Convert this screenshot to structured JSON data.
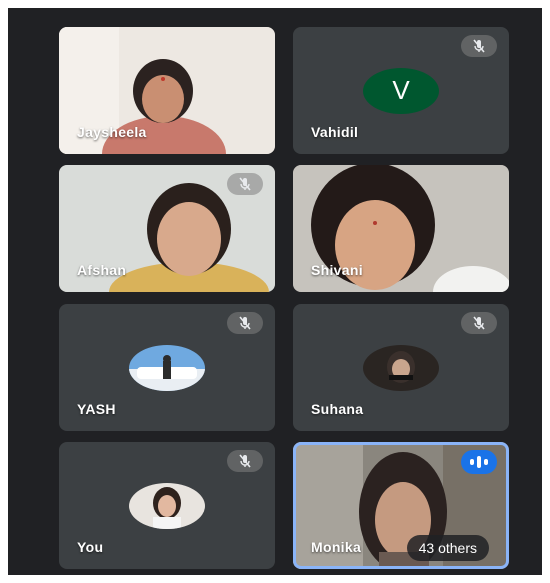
{
  "participants": [
    {
      "name": "Jaysheela",
      "muted": false,
      "type": "video"
    },
    {
      "name": "Vahidil",
      "muted": true,
      "type": "initial",
      "initial": "V",
      "color": "#00572f"
    },
    {
      "name": "Afshan",
      "muted": true,
      "type": "video"
    },
    {
      "name": "Shivani",
      "muted": false,
      "type": "video"
    },
    {
      "name": "YASH",
      "muted": true,
      "type": "avatar"
    },
    {
      "name": "Suhana",
      "muted": true,
      "type": "avatar"
    },
    {
      "name": "You",
      "muted": true,
      "type": "avatar"
    },
    {
      "name": "Monika",
      "muted": false,
      "type": "video",
      "speaking": true
    }
  ],
  "others_label": "43 others",
  "colors": {
    "background": "#202124",
    "tile": "#3c4043",
    "speaking": "#1a73e8"
  }
}
